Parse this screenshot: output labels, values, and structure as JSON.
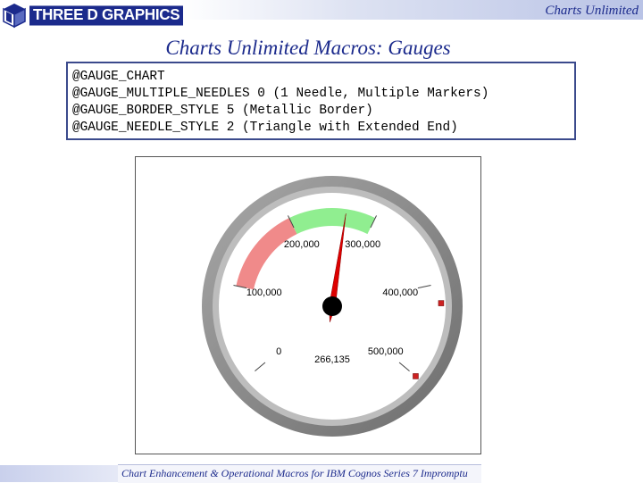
{
  "header": {
    "logo_text": "THREE D GRAPHICS",
    "brand": "Charts Unlimited"
  },
  "slide": {
    "title": "Charts Unlimited Macros: Gauges",
    "code_lines": [
      "@GAUGE_CHART",
      "@GAUGE_MULTIPLE_NEEDLES 0 (1 Needle, Multiple Markers)",
      "@GAUGE_BORDER_STYLE 5 (Metallic Border)",
      "@GAUGE_NEEDLE_STYLE 2 (Triangle with Extended End)"
    ]
  },
  "footer": {
    "text": "Chart Enhancement & Operational Macros for IBM Cognos Series 7 Impromptu"
  },
  "colors": {
    "brand_blue": "#1b2a8c",
    "range_red": "#f08a8a",
    "range_green": "#90ee90",
    "needle": "#dd0000",
    "marker": "#cc2222"
  },
  "chart_data": {
    "type": "gauge",
    "min": 0,
    "max": 500000,
    "tick_labels": [
      "0",
      "100,000",
      "200,000",
      "300,000",
      "400,000",
      "500,000"
    ],
    "ticks": [
      0,
      100000,
      200000,
      300000,
      400000,
      500000
    ],
    "value": 266135,
    "value_label": "266,135",
    "ranges": [
      {
        "from": 100000,
        "to": 200000,
        "color": "red"
      },
      {
        "from": 200000,
        "to": 300000,
        "color": "green"
      }
    ],
    "markers": [
      420000,
      500000
    ]
  }
}
